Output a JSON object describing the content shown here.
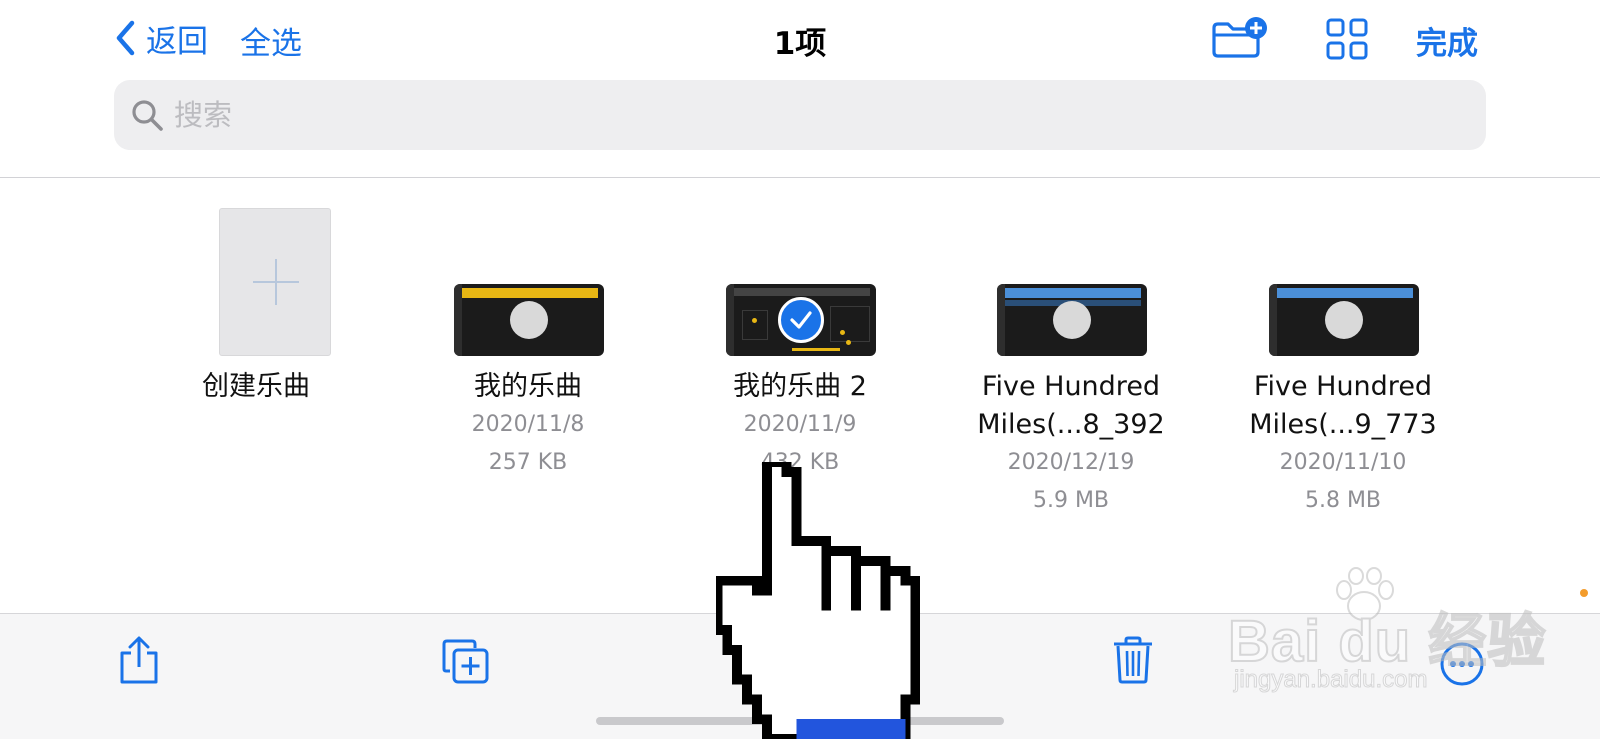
{
  "header": {
    "back_label": "返回",
    "select_all_label": "全选",
    "title": "1项",
    "done_label": "完成"
  },
  "search": {
    "placeholder": "搜索"
  },
  "items": [
    {
      "name": "创建乐曲",
      "type": "create"
    },
    {
      "name": "我的乐曲",
      "date": "2020/11/8",
      "size": "257 KB",
      "selected": false,
      "thumb": "yellow"
    },
    {
      "name": "我的乐曲 2",
      "date": "2020/11/9",
      "size": "432 KB",
      "selected": true,
      "thumb": "yellow"
    },
    {
      "name_line1": "Five Hundred",
      "name_line2": "Miles(...8_392",
      "date": "2020/12/19",
      "size": "5.9 MB",
      "selected": false,
      "thumb": "blue"
    },
    {
      "name_line1": "Five Hundred",
      "name_line2": "Miles(...9_773",
      "date": "2020/11/10",
      "size": "5.8 MB",
      "selected": false,
      "thumb": "blue"
    }
  ],
  "watermark": {
    "brand": "Bai du 经验",
    "url": "jingyan.baidu.com"
  },
  "colors": {
    "accent": "#1a73e8",
    "search_bg": "#eeeef0",
    "toolbar_bg": "#f6f6f7",
    "meta_text": "#8e8e93"
  }
}
